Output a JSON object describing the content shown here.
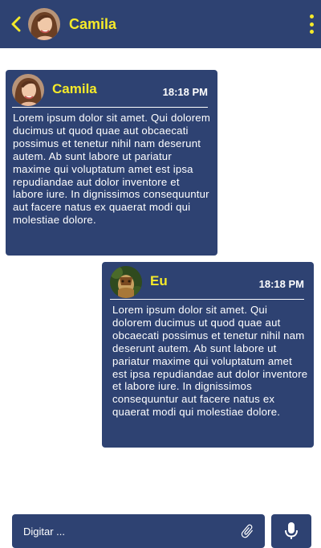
{
  "header": {
    "contact_name": "Camila",
    "icons": {
      "back": "chevron-left-icon",
      "menu": "more-vertical-icon"
    }
  },
  "messages": [
    {
      "sender": "Camila",
      "time": "18:18 PM",
      "text": "Lorem ipsum dolor sit amet. Qui dolorem ducimus ut quod quae aut obcaecati possimus et tenetur nihil nam deserunt autem. Ab sunt labore ut pariatur maxime qui voluptatum amet est ipsa repudiandae aut dolor inventore et labore iure. In dignissimos consequuntur aut facere natus ex quaerat modi qui molestiae dolore."
    },
    {
      "sender": "Eu",
      "time": "18:18 PM",
      "text": "Lorem ipsum dolor sit amet. Qui dolorem ducimus ut quod quae aut obcaecati possimus et tenetur nihil nam deserunt autem. Ab sunt labore ut pariatur maxime qui voluptatum amet est ipsa repudiandae aut dolor inventore et labore iure. In dignissimos consequuntur aut facere natus ex quaerat modi qui molestiae dolore."
    }
  ],
  "composer": {
    "placeholder": "Digitar ...",
    "icons": {
      "attach": "paperclip-icon",
      "mic": "microphone-icon"
    }
  },
  "colors": {
    "primary": "#2e4272",
    "accent": "#f5ea2a",
    "text": "#ffffff",
    "background": "#ffffff"
  }
}
